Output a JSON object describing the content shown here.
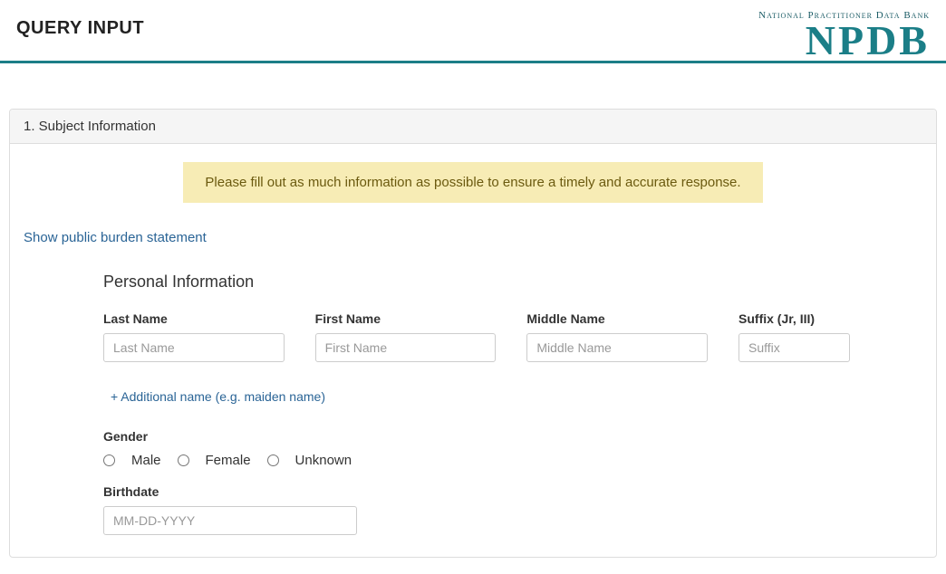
{
  "header": {
    "title": "QUERY INPUT",
    "logo_caption": "National Practitioner Data Bank",
    "logo_text": "NPDB"
  },
  "panel": {
    "heading": "1. Subject Information",
    "alert": "Please fill out as much information as possible to ensure a timely and accurate response.",
    "burden_link": "Show public burden statement",
    "section_title": "Personal Information",
    "fields": {
      "last_name": {
        "label": "Last Name",
        "placeholder": "Last Name",
        "value": ""
      },
      "first_name": {
        "label": "First Name",
        "placeholder": "First Name",
        "value": ""
      },
      "middle_name": {
        "label": "Middle Name",
        "placeholder": "Middle Name",
        "value": ""
      },
      "suffix": {
        "label": "Suffix (Jr, III)",
        "placeholder": "Suffix",
        "value": ""
      }
    },
    "additional_name_link": "+ Additional name (e.g. maiden name)",
    "gender": {
      "label": "Gender",
      "options": {
        "male": "Male",
        "female": "Female",
        "unknown": "Unknown"
      },
      "value": ""
    },
    "birthdate": {
      "label": "Birthdate",
      "placeholder": "MM-DD-YYYY",
      "value": ""
    }
  }
}
